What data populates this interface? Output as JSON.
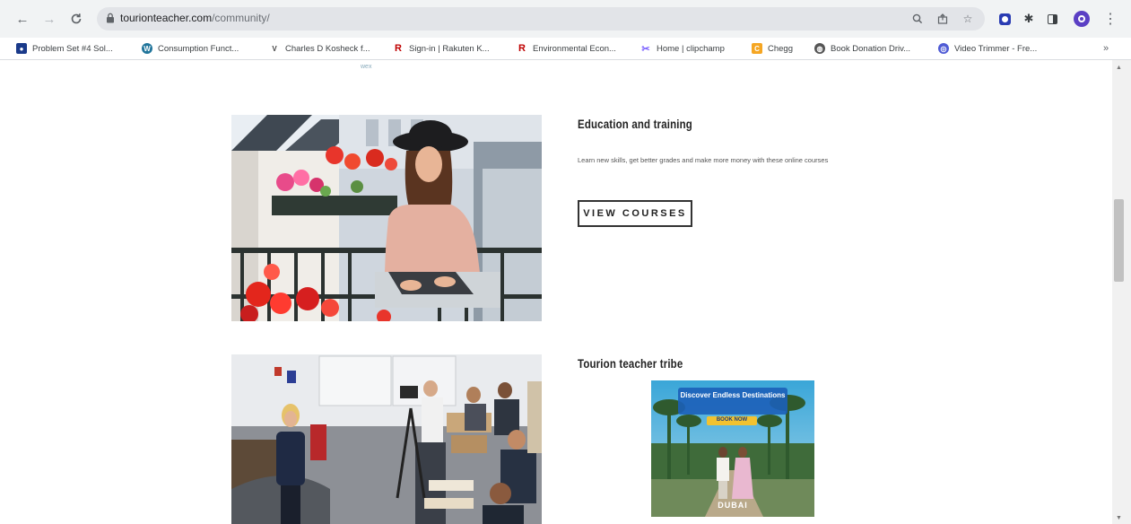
{
  "browser": {
    "url_domain": "tourionteacher.com",
    "url_path": "/community/",
    "bookmarks": [
      {
        "label": "Problem Set #4 Sol...",
        "icon": "bookmark-favicon-icon",
        "color": "#1a3a8a"
      },
      {
        "label": "Consumption Funct...",
        "icon": "wordpress-icon",
        "color": "#21759b"
      },
      {
        "label": "Charles D Kosheck f...",
        "icon": "v-icon",
        "color": "#444444"
      },
      {
        "label": "Sign-in | Rakuten K...",
        "icon": "rakuten-icon",
        "color": "#bf0000"
      },
      {
        "label": "Environmental Econ...",
        "icon": "rakuten-icon",
        "color": "#bf0000"
      },
      {
        "label": "Home | clipchamp",
        "icon": "clipchamp-icon",
        "color": "#7b61ff"
      },
      {
        "label": "Chegg",
        "icon": "chegg-icon",
        "color": "#f5a623"
      },
      {
        "label": "Book Donation Driv...",
        "icon": "globe-icon",
        "color": "#444444"
      },
      {
        "label": "Video Trimmer - Fre...",
        "icon": "video-trimmer-icon",
        "color": "#4f5bd5"
      }
    ],
    "more_bookmarks": "»"
  },
  "page": {
    "top_link_fragment": "wex",
    "section1": {
      "heading": "Education and training",
      "description": "Learn new skills, get better grades and make more money with these online courses",
      "button_label": "VIEW COURSES"
    },
    "section2": {
      "heading": "Tourion teacher tribe",
      "ad_headline": "Discover Endless Destinations",
      "ad_cta": "BOOK NOW",
      "ad_brand": "DUBAI"
    }
  },
  "colors": {
    "toolbar_bg": "#f1f3f4",
    "omnibox_bg": "#e2e4e8",
    "button_border": "#333333",
    "heading_text": "#222222"
  }
}
